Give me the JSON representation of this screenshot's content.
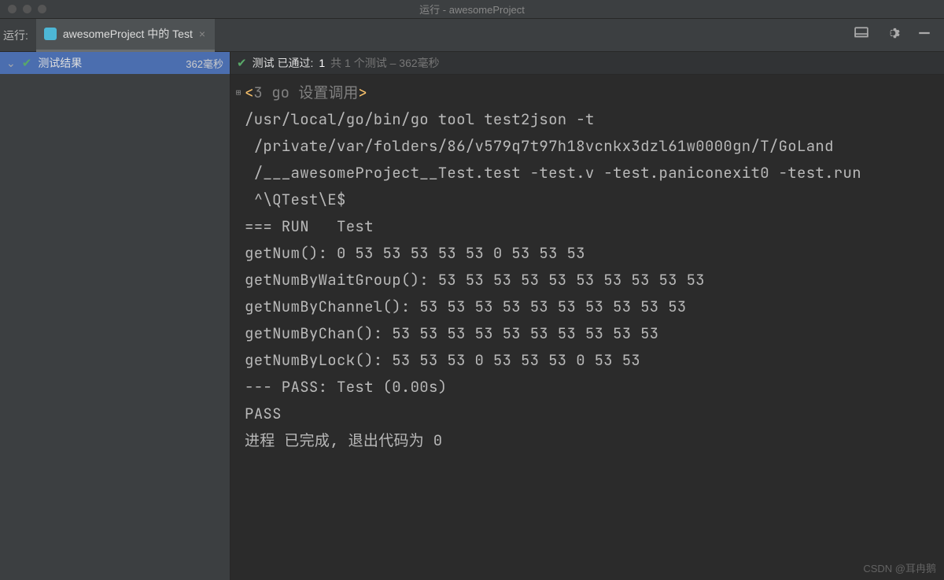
{
  "window": {
    "title": "运行 - awesomeProject"
  },
  "toolbar": {
    "run_label": "运行:",
    "tab_label": "awesomeProject 中的 Test",
    "tab_close": "×"
  },
  "tree": {
    "chevron": "⌄",
    "root_label": "测试结果",
    "root_time": "362毫秒"
  },
  "status": {
    "prefix": "测试 已通过: ",
    "count": "1",
    "suffix": "共 1 个测试 – 362毫秒"
  },
  "console": {
    "fold_count": "3",
    "fold_text": "go 设置调用",
    "lines": [
      "/usr/local/go/bin/go tool test2json -t",
      " /private/var/folders/86/v579q7t97h18vcnkx3dzl61w0000gn/T/GoLand",
      " /___awesomeProject__Test.test -test.v -test.paniconexit0 -test.run",
      " ^\\QTest\\E$",
      "=== RUN   Test",
      "getNum(): 0 53 53 53 53 53 0 53 53 53",
      "getNumByWaitGroup(): 53 53 53 53 53 53 53 53 53 53",
      "getNumByChannel(): 53 53 53 53 53 53 53 53 53 53",
      "getNumByChan(): 53 53 53 53 53 53 53 53 53 53",
      "getNumByLock(): 53 53 53 0 53 53 53 0 53 53",
      "--- PASS: Test (0.00s)",
      "PASS",
      "",
      "进程 已完成, 退出代码为 0"
    ]
  },
  "watermark": "CSDN @耳冉鹅"
}
